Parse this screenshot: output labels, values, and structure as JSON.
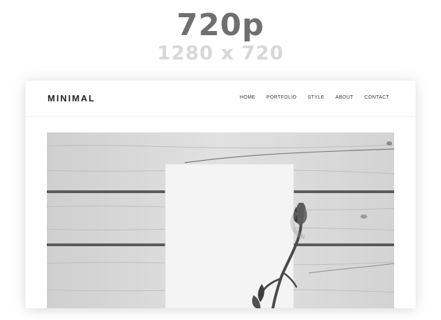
{
  "resolution": {
    "title": "720p",
    "subtitle": "1280 x 720"
  },
  "site": {
    "logo": "MINIMAL",
    "menu": [
      {
        "label": "HOME"
      },
      {
        "label": "PORTFOLIO"
      },
      {
        "label": "STYLE"
      },
      {
        "label": "ABOUT"
      },
      {
        "label": "CONTACT"
      }
    ]
  },
  "hero": {
    "image": "white-wooden-planks-with-blank-card-and-flower"
  }
}
